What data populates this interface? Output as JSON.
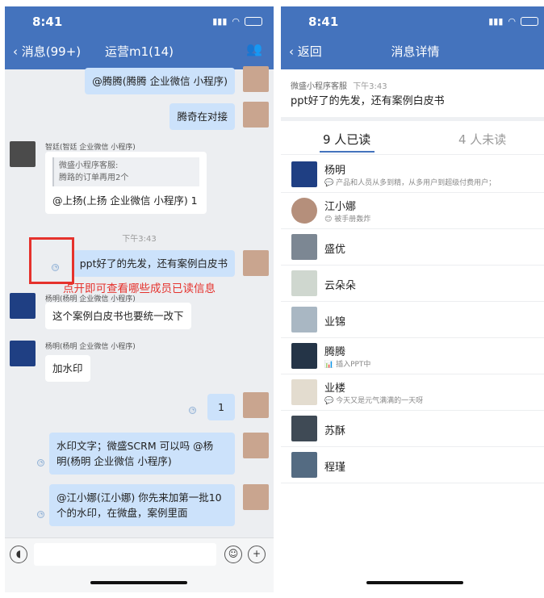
{
  "status_time": "8:41",
  "left": {
    "nav_back": "消息(99+)",
    "title": "运营m1(14)",
    "messages": {
      "m1": "@腾腾(腾腾 企业微信 小程序)",
      "m2": "腾奇在对接",
      "m3_sender": "智廷(智廷 企业微信 小程序)",
      "m3_quote_line1": "微盛小程序客服:",
      "m3_quote_line2": "腾路的订单再用2个",
      "m3_text": "@上扬(上扬 企业微信 小程序) 1",
      "time_label": "下午3:43",
      "m4": "ppt好了的先发，还有案例白皮书",
      "annotation": "点开即可查看哪些成员已读信息",
      "m5_sender": "杨明(杨明 企业微信 小程序)",
      "m5": "这个案例白皮书也要统一改下",
      "m6_sender": "杨明(杨明 企业微信 小程序)",
      "m6": "加水印",
      "m7": "1",
      "m8_line1": "水印文字；微盛SCRM 可以吗 @杨",
      "m8_line2": "明(杨明 企业微信 小程序)",
      "m9_line1": "@江小娜(江小娜) 你先来加第一批10",
      "m9_line2": "个的水印，在微盘，案例里面"
    }
  },
  "right": {
    "nav_back": "返回",
    "title": "消息详情",
    "sender": "微盛小程序客服",
    "sent_time": "下午3:43",
    "message": "ppt好了的先发，还有案例白皮书",
    "tab_read": "9 人已读",
    "tab_unread": "4 人未读",
    "readers": [
      {
        "name": "杨明",
        "status": "产品和人员从多到精，从多用户到超级付费用户；"
      },
      {
        "name": "江小娜",
        "status": "被手册轰炸"
      },
      {
        "name": "盛优",
        "status": ""
      },
      {
        "name": "云朵朵",
        "status": ""
      },
      {
        "name": "业锦",
        "status": ""
      },
      {
        "name": "腾腾",
        "status": "插入PPT中"
      },
      {
        "name": "业楼",
        "status": "今天又是元气满满的一天呀"
      },
      {
        "name": "苏酥",
        "status": ""
      },
      {
        "name": "程瑾",
        "status": ""
      }
    ]
  },
  "colors": {
    "nav_blue": "#4473bd",
    "bubble_me": "#cce2fb",
    "annotation_red": "#e5322d",
    "tab_accent": "#4473bd"
  }
}
